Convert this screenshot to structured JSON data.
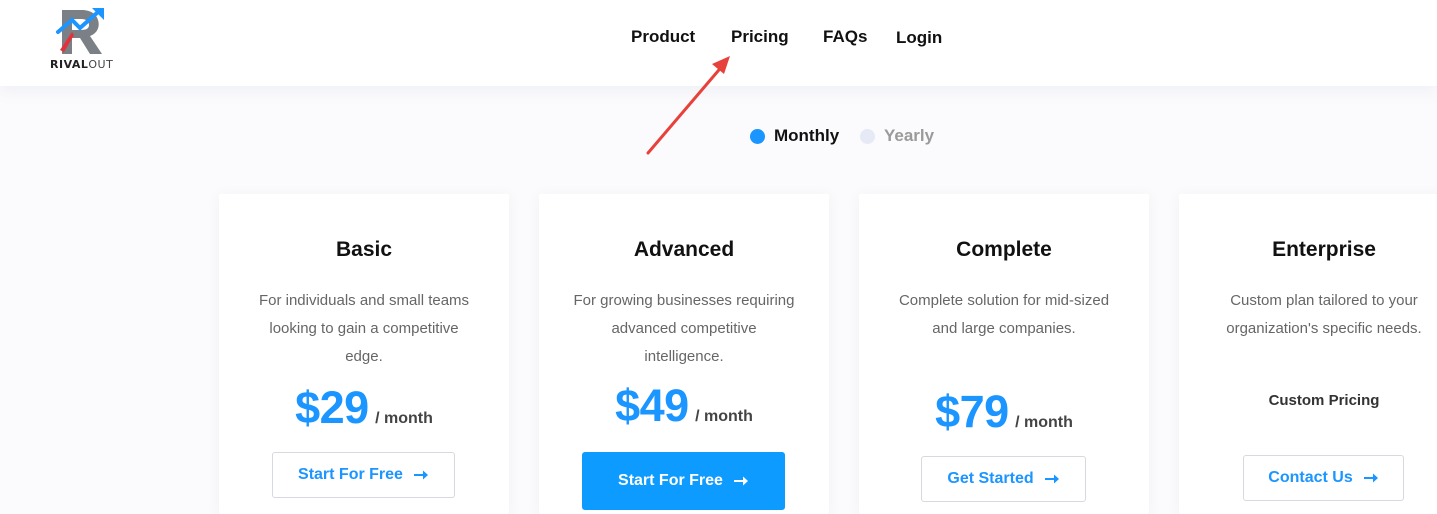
{
  "brand": {
    "name_bold": "RIVAL",
    "name_light": "OUT"
  },
  "nav": {
    "items": [
      {
        "label": "Product"
      },
      {
        "label": "Pricing"
      },
      {
        "label": "FAQs"
      },
      {
        "label": "Login"
      }
    ]
  },
  "billing_toggle": {
    "monthly_label": "Monthly",
    "yearly_label": "Yearly",
    "selected": "Monthly"
  },
  "plans": [
    {
      "name": "Basic",
      "description": "For individuals and small teams looking to gain a competitive edge.",
      "price": "$29",
      "period": "/ month",
      "button_label": "Start For Free"
    },
    {
      "name": "Advanced",
      "description": "For growing businesses requiring advanced competitive intelligence.",
      "price": "$49",
      "period": "/ month",
      "button_label": "Start For Free"
    },
    {
      "name": "Complete",
      "description": "Complete solution for mid-sized and large companies.",
      "price": "$79",
      "period": "/ month",
      "button_label": "Get Started"
    },
    {
      "name": "Enterprise",
      "description": "Custom plan tailored to your organization's specific needs.",
      "custom_pricing": "Custom Pricing",
      "button_label": "Contact Us"
    }
  ],
  "icons": {
    "logo": "rivalout-logo-icon",
    "button_arrow": "arrow-right-icon",
    "annotation": "red-annotation-arrow-icon"
  },
  "colors": {
    "accent": "#1b95ff",
    "button_fill": "#0e9bff",
    "annotation": "#e8403a",
    "text": "#111111",
    "muted": "#666666"
  }
}
